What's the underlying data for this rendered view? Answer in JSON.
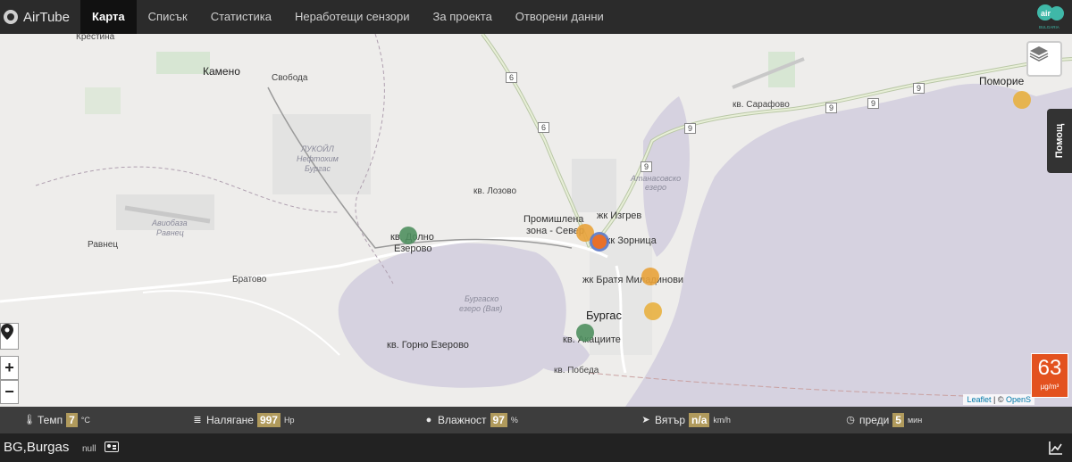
{
  "app": {
    "brand": "AirTube"
  },
  "nav": {
    "items": [
      "Карта",
      "Списък",
      "Статистика",
      "Неработещи сензори",
      "За проекта",
      "Отворени данни"
    ],
    "active": "Карта"
  },
  "logo": {
    "text": "BULGARIA"
  },
  "map": {
    "labels": {
      "krastina": "Крестина",
      "kameno": "Камено",
      "svoboda": "Свобода",
      "lukoil": "ЛУКОЙЛ",
      "neftohim": "Нефтохим",
      "burgas_small": "Бургас",
      "aviobaza": "Авиобаза",
      "ravnets_base": "Равнец",
      "ravnets": "Равнец",
      "bratovo": "Братово",
      "dolno_ezerovo_1": "кв. Долно",
      "dolno_ezerovo_2": "Езерово",
      "lozovo": "кв. Лозово",
      "promishlena_1": "Промишлена",
      "promishlena_2": "зона - Север",
      "izgrev": "жк Изгрев",
      "zornitsa": "жк Зорница",
      "bratya_miladinovi": "жк Братя Миладинови",
      "burgas": "Бургас",
      "akatsiite": "кв. Акациите",
      "pobeda": "кв. Победа",
      "gorno_ezerovo": "кв. Горно Езерово",
      "burgasko_ezero_1": "Бургаско",
      "burgasko_ezero_2": "езеро (Вая)",
      "atanasovsko_1": "Атанасовско",
      "atanasovsko_2": "езеро",
      "sarafovo": "кв. Сарафово",
      "pomorie": "Поморие",
      "road_6a": "6",
      "road_6b": "6",
      "road_9a": "9",
      "road_9b": "9",
      "road_9c": "9",
      "road_9d": "9",
      "road_9e": "9"
    },
    "markers_colors": {
      "green": "#4f8f5f",
      "orange": "#e8a23a",
      "dark_orange": "#e8702a",
      "blue": "#5a78c8"
    },
    "help_label": "Помощ",
    "zoom_in": "+",
    "zoom_out": "−",
    "attribution_leaflet": "Leaflet",
    "attribution_sep": " | © ",
    "attribution_osm": "OpenS"
  },
  "aqi": {
    "value": "63",
    "unit": "µg/m³",
    "color": "#e3521f"
  },
  "weather": {
    "temp": {
      "label": "Темп",
      "value": "7",
      "unit": "°C"
    },
    "pressure": {
      "label": "Налягане",
      "value": "997",
      "unit": "Hp"
    },
    "humidity": {
      "label": "Влажност",
      "value": "97",
      "unit": "%"
    },
    "wind": {
      "label": "Вятър",
      "value": "n/a",
      "unit": "km/h"
    },
    "ago": {
      "label": "преди",
      "value": "5",
      "unit": "мин"
    }
  },
  "station": {
    "name": "BG,Burgas",
    "extra": "null"
  }
}
